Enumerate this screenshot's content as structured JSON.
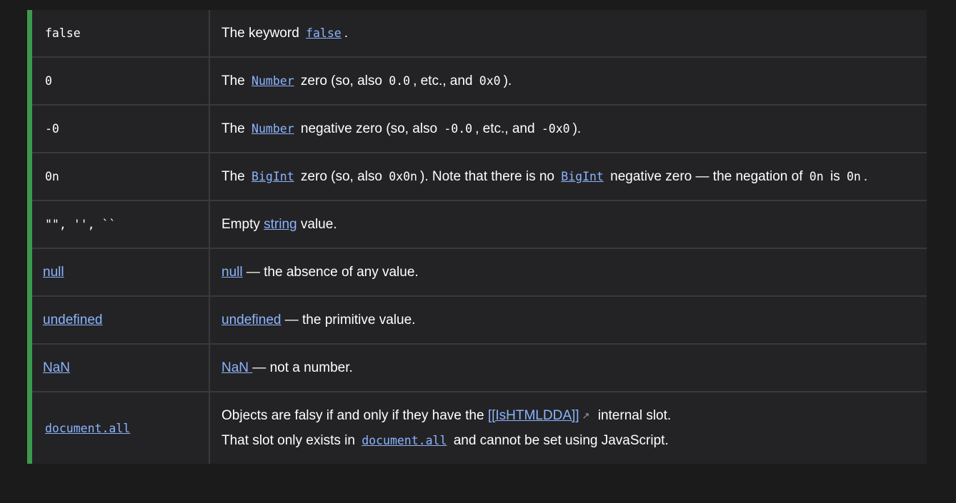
{
  "rows": [
    {
      "value": "false",
      "desc_prefix": "The keyword ",
      "desc_link": "false",
      "desc_suffix": "."
    },
    {
      "value": "0",
      "pre": "The ",
      "link": "Number",
      "mid1": " zero (so, also ",
      "code1": "0.0",
      "mid2": ", etc., and ",
      "code2": "0x0",
      "end": ")."
    },
    {
      "value": "-0",
      "pre": "The ",
      "link": "Number",
      "mid1": " negative zero (so, also ",
      "code1": "-0.0",
      "mid2": ", etc., and ",
      "code2": "-0x0",
      "end": ")."
    },
    {
      "value": "0n",
      "pre": "The ",
      "link1": "BigInt",
      "mid1": " zero (so, also ",
      "code1": "0x0n",
      "mid2": "). Note that there is no ",
      "link2": "BigInt",
      "mid3": " negative zero — the negation of ",
      "code2": "0n",
      "mid4": " is ",
      "code3": "0n",
      "end": "."
    },
    {
      "value": "\"\", '', ``",
      "pre": "Empty ",
      "link": "string",
      "end": " value."
    },
    {
      "value": "null",
      "link": "null",
      "end": " — the absence of any value."
    },
    {
      "value": "undefined",
      "link": "undefined",
      "end": " — the primitive value."
    },
    {
      "value": "NaN",
      "link": "NaN ",
      "end": "— not a number."
    },
    {
      "value": "document.all",
      "line1_pre": "Objects are falsy if and only if they have the ",
      "line1_link": "[[IsHTMLDDA]]",
      "line1_end": " internal slot.",
      "line2_pre": "That slot only exists in ",
      "line2_code": "document.all",
      "line2_end": " and cannot be set using JavaScript."
    }
  ],
  "colors": {
    "accent": "#3d9a4c",
    "link": "#8cb4ff",
    "background": "#1b1b1c",
    "table": "#232325"
  }
}
